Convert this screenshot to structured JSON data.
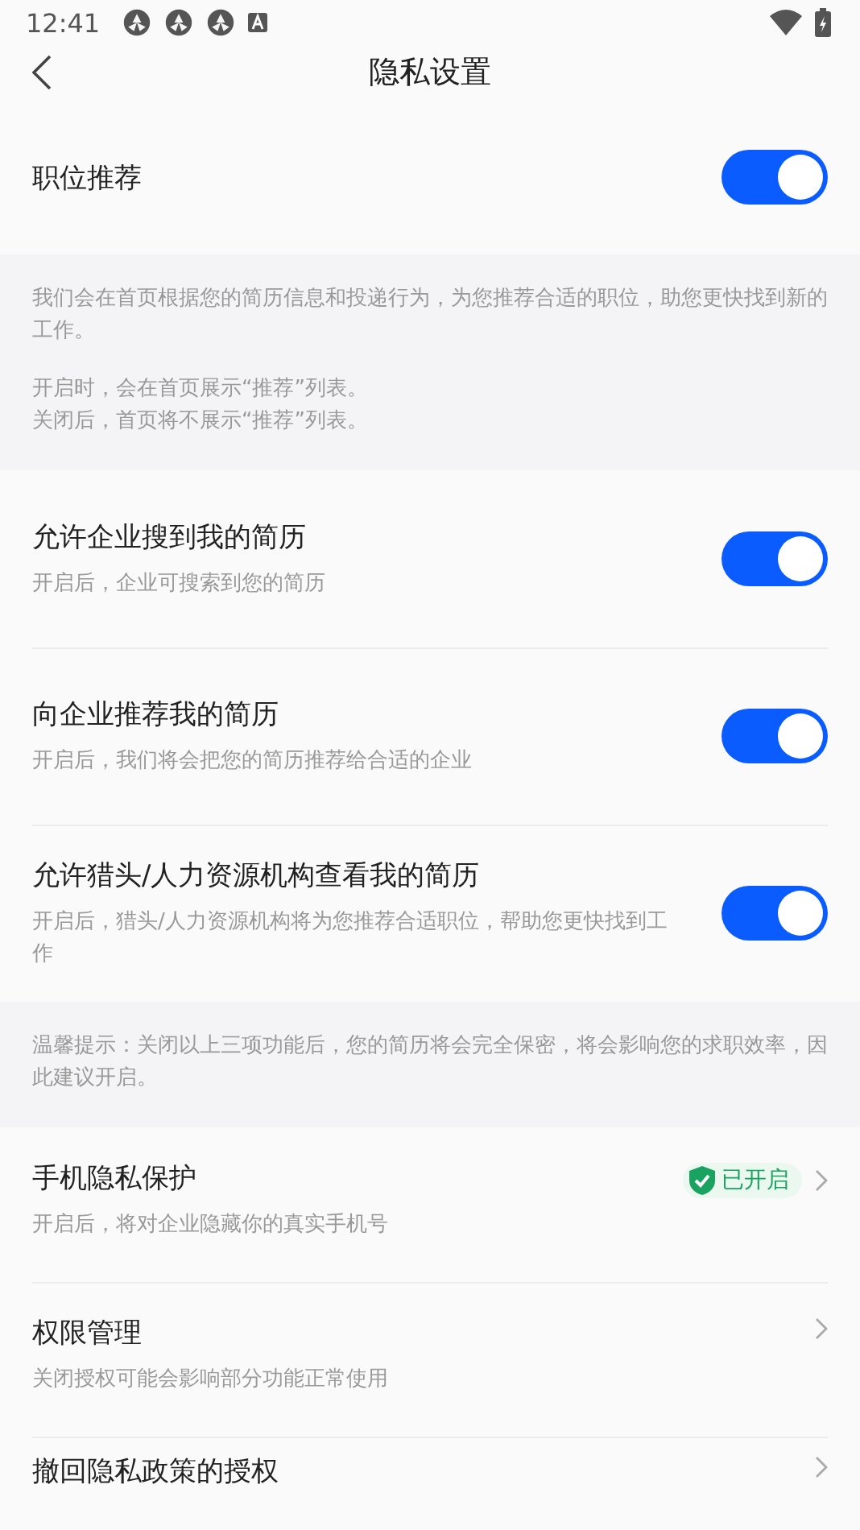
{
  "status_bar": {
    "time": "12:41"
  },
  "nav": {
    "title": "隐私设置"
  },
  "sections": [
    {
      "kind": "toggle_row",
      "title": "职位推荐",
      "on": true
    },
    {
      "kind": "note",
      "paragraphs": [
        [
          "我们会在首页根据您的简历信息和投递行为，为您推荐合适的职位，助您更快找到新的工作。"
        ],
        [
          "开启时，会在首页展示“推荐”列表。",
          "关闭后，首页将不展示“推荐”列表。"
        ]
      ]
    },
    {
      "kind": "toggle_row",
      "title": "允许企业搜到我的简历",
      "subtitle": "开启后，企业可搜索到您的简历",
      "on": true
    },
    {
      "kind": "toggle_row",
      "title": "向企业推荐我的简历",
      "subtitle": "开启后，我们将会把您的简历推荐给合适的企业",
      "on": true
    },
    {
      "kind": "toggle_row",
      "title": "允许猎头/人力资源机构查看我的简历",
      "subtitle": "开启后，猎头/人力资源机构将为您推荐合适职位，帮助您更快找到工作",
      "on": true
    },
    {
      "kind": "note",
      "paragraphs": [
        [
          "温馨提示：关闭以上三项功能后，您的简历将会完全保密，将会影响您的求职效率，因此建议开启。"
        ]
      ]
    },
    {
      "kind": "link_row",
      "title": "手机隐私保护",
      "subtitle": "开启后，将对企业隐藏你的真实手机号",
      "badge": "已开启"
    },
    {
      "kind": "link_row",
      "title": "权限管理",
      "subtitle": "关闭授权可能会影响部分功能正常使用"
    },
    {
      "kind": "link_row",
      "title": "撤回隐私政策的授权"
    }
  ]
}
